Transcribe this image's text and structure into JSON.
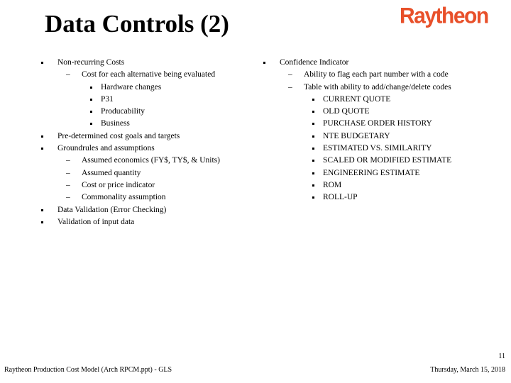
{
  "slide": {
    "title": "Data Controls (2)",
    "logo_text": "Raytheon",
    "brand_color": "#e8502a"
  },
  "left_column": {
    "items": [
      {
        "level": 1,
        "marker": "square-bullet",
        "text": "Non-recurring Costs"
      },
      {
        "level": 2,
        "marker": "dash",
        "text": "Cost for each alternative being evaluated"
      },
      {
        "level": 3,
        "marker": "square-bullet",
        "text": "Hardware changes"
      },
      {
        "level": 3,
        "marker": "square-bullet",
        "text": "P31"
      },
      {
        "level": 3,
        "marker": "square-bullet",
        "text": "Producability"
      },
      {
        "level": 3,
        "marker": "square-bullet",
        "text": "Business"
      },
      {
        "level": 1,
        "marker": "square-bullet",
        "text": "Pre-determined cost goals and targets"
      },
      {
        "level": 1,
        "marker": "square-bullet",
        "text": "Groundrules and assumptions"
      },
      {
        "level": 2,
        "marker": "dash",
        "text": "Assumed economics (FY$, TY$, & Units)"
      },
      {
        "level": 2,
        "marker": "dash",
        "text": "Assumed quantity"
      },
      {
        "level": 2,
        "marker": "dash",
        "text": "Cost or price indicator"
      },
      {
        "level": 2,
        "marker": "dash",
        "text": "Commonality assumption"
      },
      {
        "level": 1,
        "marker": "square-bullet",
        "text": "Data Validation (Error Checking)"
      },
      {
        "level": 1,
        "marker": "square-bullet",
        "text": "Validation of input data"
      }
    ]
  },
  "right_column": {
    "items": [
      {
        "level": 1,
        "marker": "square-bullet",
        "text": "Confidence Indicator"
      },
      {
        "level": 2,
        "marker": "dash",
        "text": "Ability to flag each part number with a code"
      },
      {
        "level": 2,
        "marker": "dash",
        "text": "Table with ability to add/change/delete codes"
      },
      {
        "level": 3,
        "marker": "square-bullet",
        "text": "CURRENT QUOTE"
      },
      {
        "level": 3,
        "marker": "square-bullet",
        "text": "OLD QUOTE"
      },
      {
        "level": 3,
        "marker": "square-bullet",
        "text": "PURCHASE ORDER HISTORY"
      },
      {
        "level": 3,
        "marker": "square-bullet",
        "text": "NTE BUDGETARY"
      },
      {
        "level": 3,
        "marker": "square-bullet",
        "text": "ESTIMATED VS.  SIMILARITY"
      },
      {
        "level": 3,
        "marker": "square-bullet",
        "text": "SCALED OR MODIFIED ESTIMATE"
      },
      {
        "level": 3,
        "marker": "square-bullet",
        "text": "ENGINEERING ESTIMATE"
      },
      {
        "level": 3,
        "marker": "square-bullet",
        "text": "ROM"
      },
      {
        "level": 3,
        "marker": "square-bullet",
        "text": "ROLL-UP"
      }
    ]
  },
  "footer": {
    "left_text": "Raytheon Production Cost Model (Arch RPCM.ppt) - GLS",
    "page_number": "11",
    "date": "Thursday, March 15, 2018"
  },
  "markers": {
    "dash": "–"
  }
}
